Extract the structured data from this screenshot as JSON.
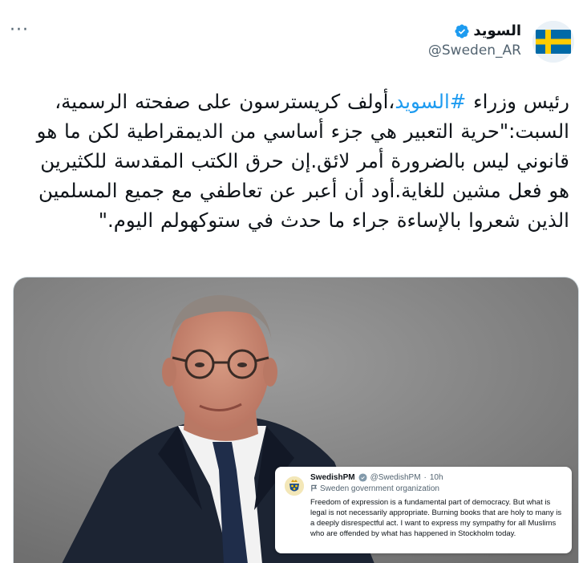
{
  "header": {
    "display_name": "السويد",
    "handle": "@Sweden_AR",
    "more_label": "···",
    "verified_color": "#1d9bf0",
    "avatar_icon": "sweden-flag-icon"
  },
  "tweet": {
    "text_before_hashtag": "رئيس وزراء ",
    "hashtag": "#السويد",
    "text_after_hashtag": "،أولف كريسترسون على صفحته الرسمية، السبت:\"حرية التعبير هي جزء أساسي من الديمقراطية لكن ما هو قانوني ليس بالضرورة أمر لائق.إن حرق الكتب المقدسة للكثيرين هو فعل مشين للغاية.أود أن أعبر عن تعاطفي مع جميع المسلمين الذين شعروا بالإساءة جراء ما حدث في ستوكهولم اليوم.\"",
    "hashtag_color": "#1d9bf0"
  },
  "embedded_tweet": {
    "name": "SwedishPM",
    "handle": "@SwedishPM",
    "separator": "·",
    "time": "10h",
    "org_label": "Sweden government organization",
    "body": "Freedom of expression is a fundamental part of democracy. But what is legal is not necessarily appropriate. Burning books that are holy to many is a deeply disrespectful act. I want to express my sympathy for all Muslims who are offended by what has happened in Stockholm today.",
    "org_icon": "flag-outline-icon",
    "verified_color": "#829aab"
  },
  "colors": {
    "flag_blue": "#006aa7",
    "flag_yellow": "#fecc00",
    "text_primary": "#0f1419",
    "text_secondary": "#536471"
  }
}
